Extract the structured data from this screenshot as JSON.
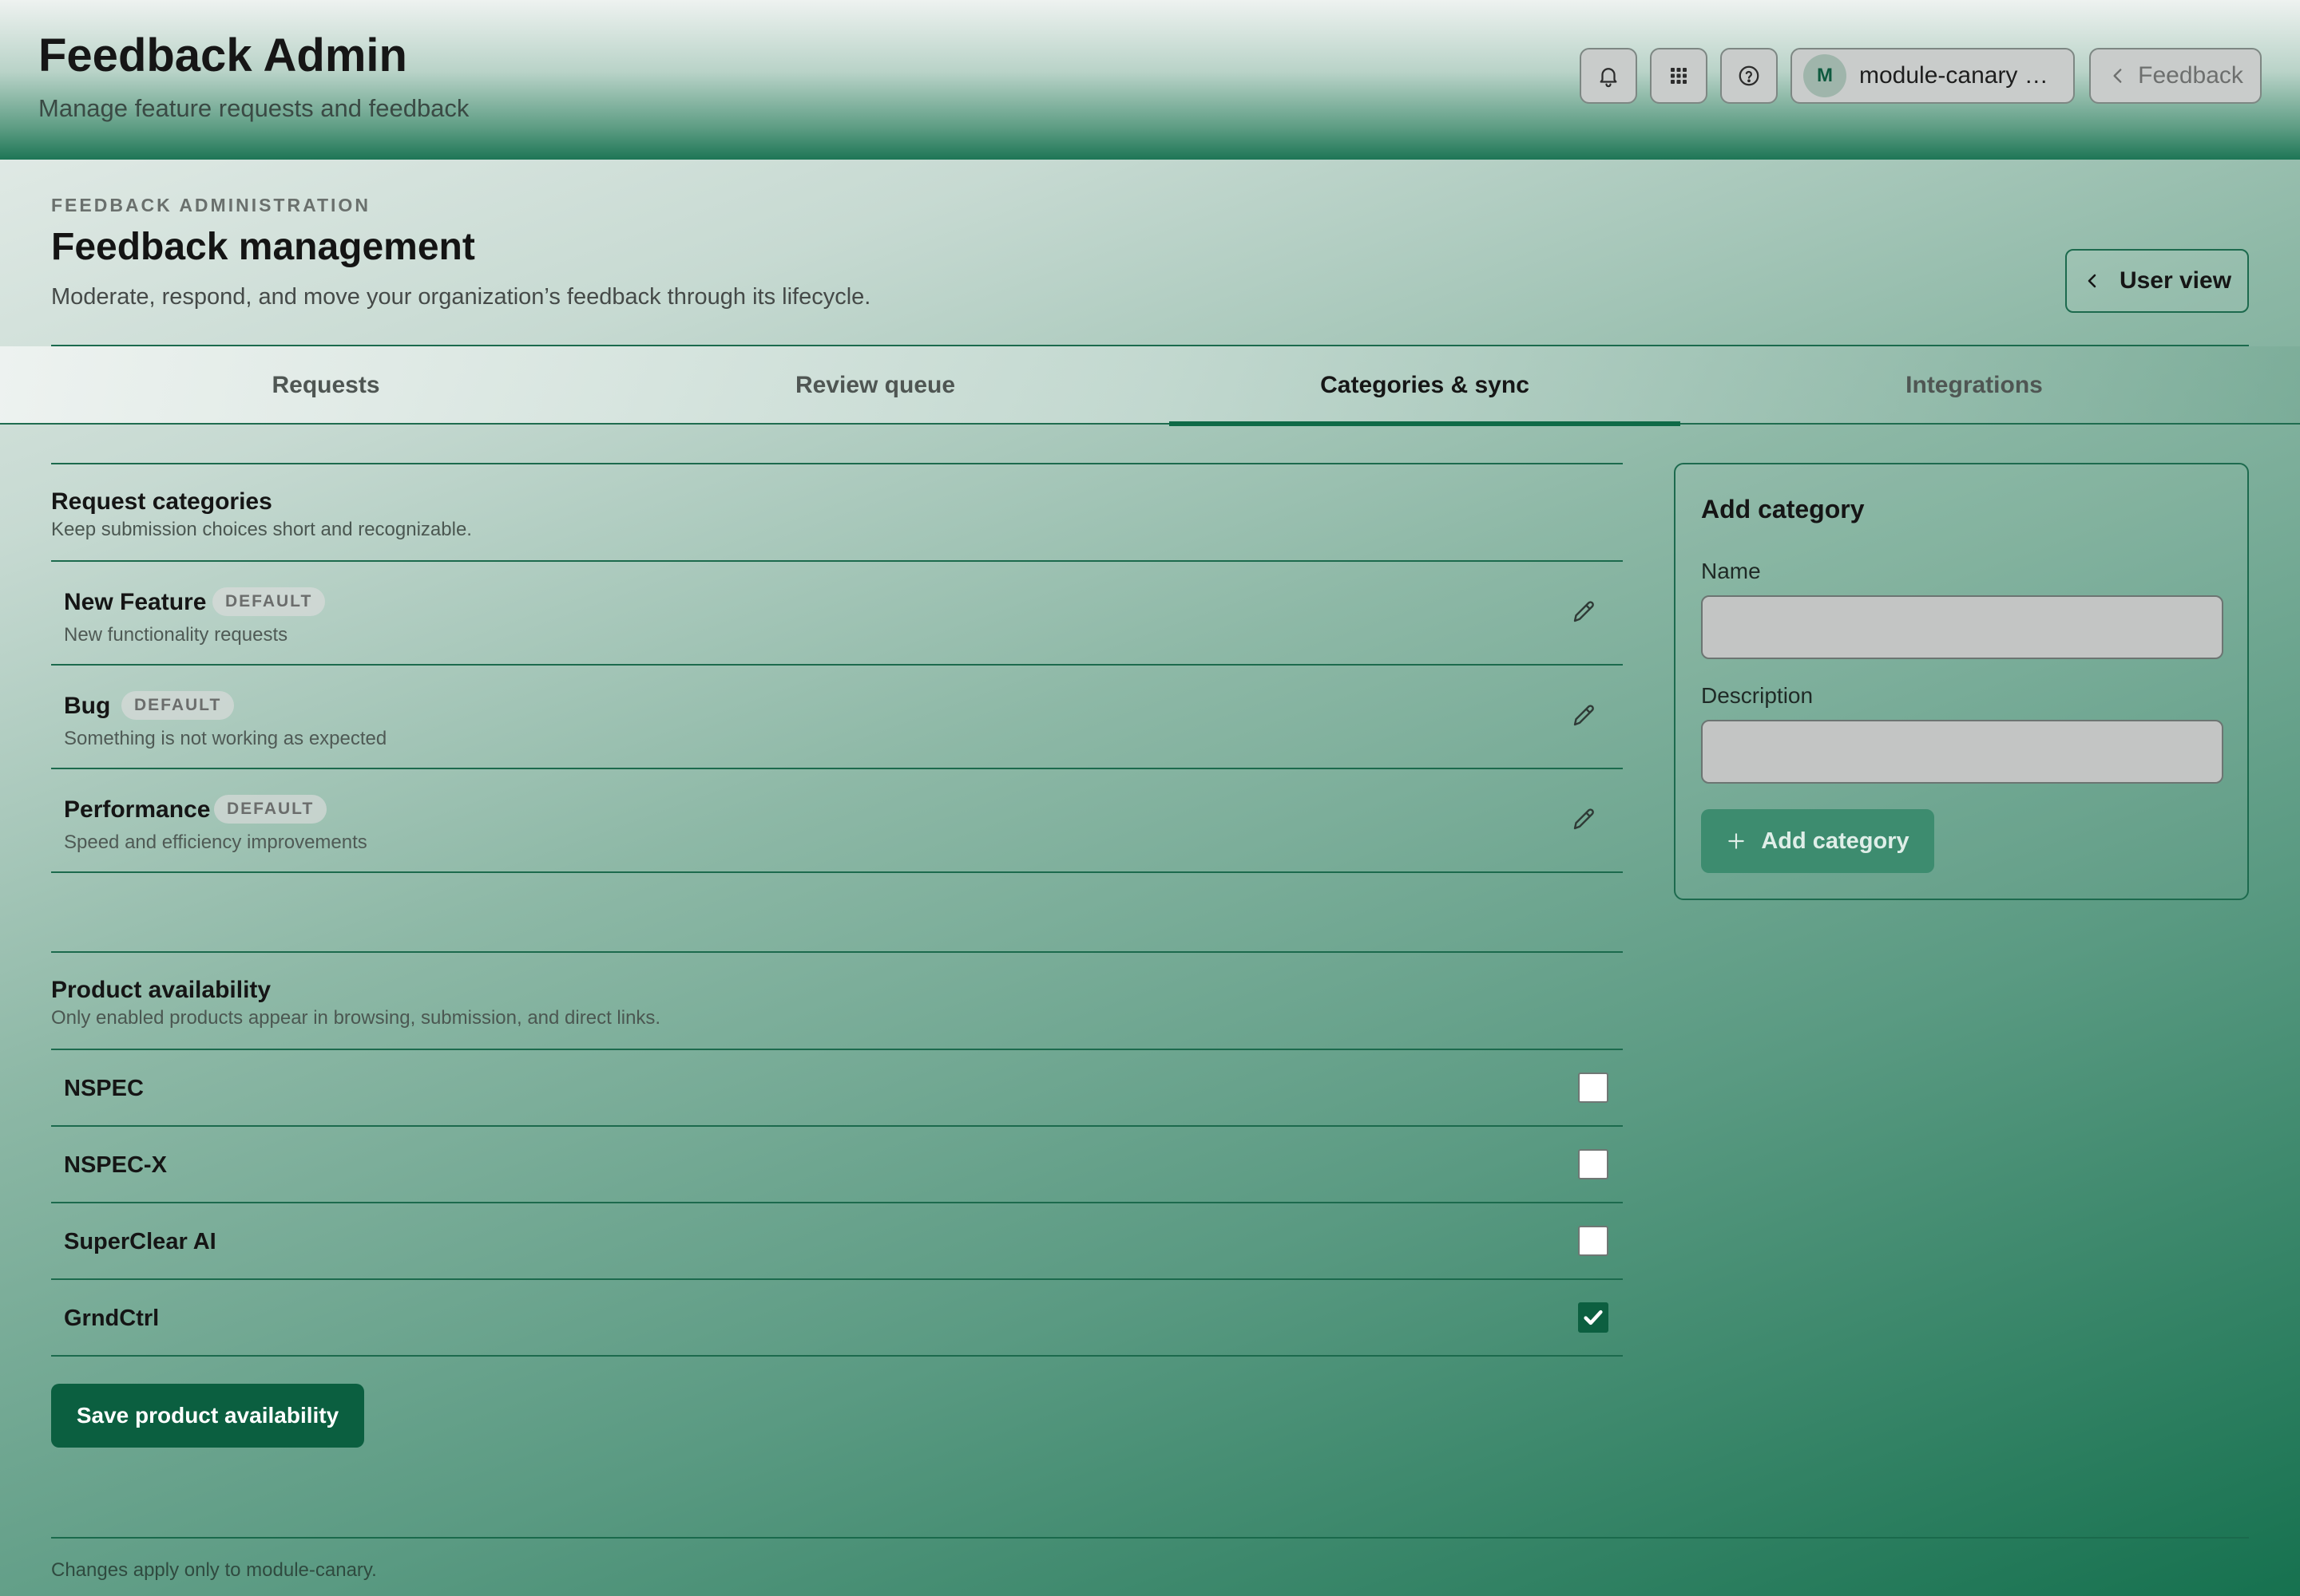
{
  "header": {
    "title": "Feedback Admin",
    "subtitle": "Manage feature requests and feedback",
    "account": {
      "initial": "M",
      "name": "module-canary S..."
    },
    "feedback_label": "Feedback",
    "icons": [
      "bell-icon",
      "grid-icon",
      "help-icon",
      "chevron-left-icon"
    ]
  },
  "page": {
    "eyebrow": "FEEDBACK ADMINISTRATION",
    "title": "Feedback management",
    "description": "Moderate, respond, and move your organization’s feedback through its lifecycle.",
    "user_view_label": "User view"
  },
  "tabs": [
    {
      "label": "Requests",
      "active": false
    },
    {
      "label": "Review queue",
      "active": false
    },
    {
      "label": "Categories & sync",
      "active": true
    },
    {
      "label": "Integrations",
      "active": false
    }
  ],
  "categories": {
    "title": "Request categories",
    "subtitle": "Keep submission choices short and recognizable.",
    "items": [
      {
        "name": "New Feature",
        "badge": "DEFAULT",
        "description": "New functionality requests"
      },
      {
        "name": "Bug",
        "badge": "DEFAULT",
        "description": "Something is not working as expected"
      },
      {
        "name": "Performance",
        "badge": "DEFAULT",
        "description": "Speed and efficiency improvements"
      }
    ]
  },
  "products": {
    "title": "Product availability",
    "subtitle": "Only enabled products appear in browsing, submission, and direct links.",
    "items": [
      {
        "name": "NSPEC",
        "enabled": false
      },
      {
        "name": "NSPEC-X",
        "enabled": false
      },
      {
        "name": "SuperClear AI",
        "enabled": false
      },
      {
        "name": "GrndCtrl",
        "enabled": true
      }
    ],
    "save_label": "Save product availability"
  },
  "add_category": {
    "title": "Add category",
    "name_label": "Name",
    "name_value": "",
    "description_label": "Description",
    "description_value": "",
    "button_label": "Add category"
  },
  "footer": {
    "note": "Changes apply only to module-canary."
  },
  "colors": {
    "accent": "#0b5f40",
    "accent_muted": "#3d8c6f",
    "rule": "#1c6a4d"
  }
}
